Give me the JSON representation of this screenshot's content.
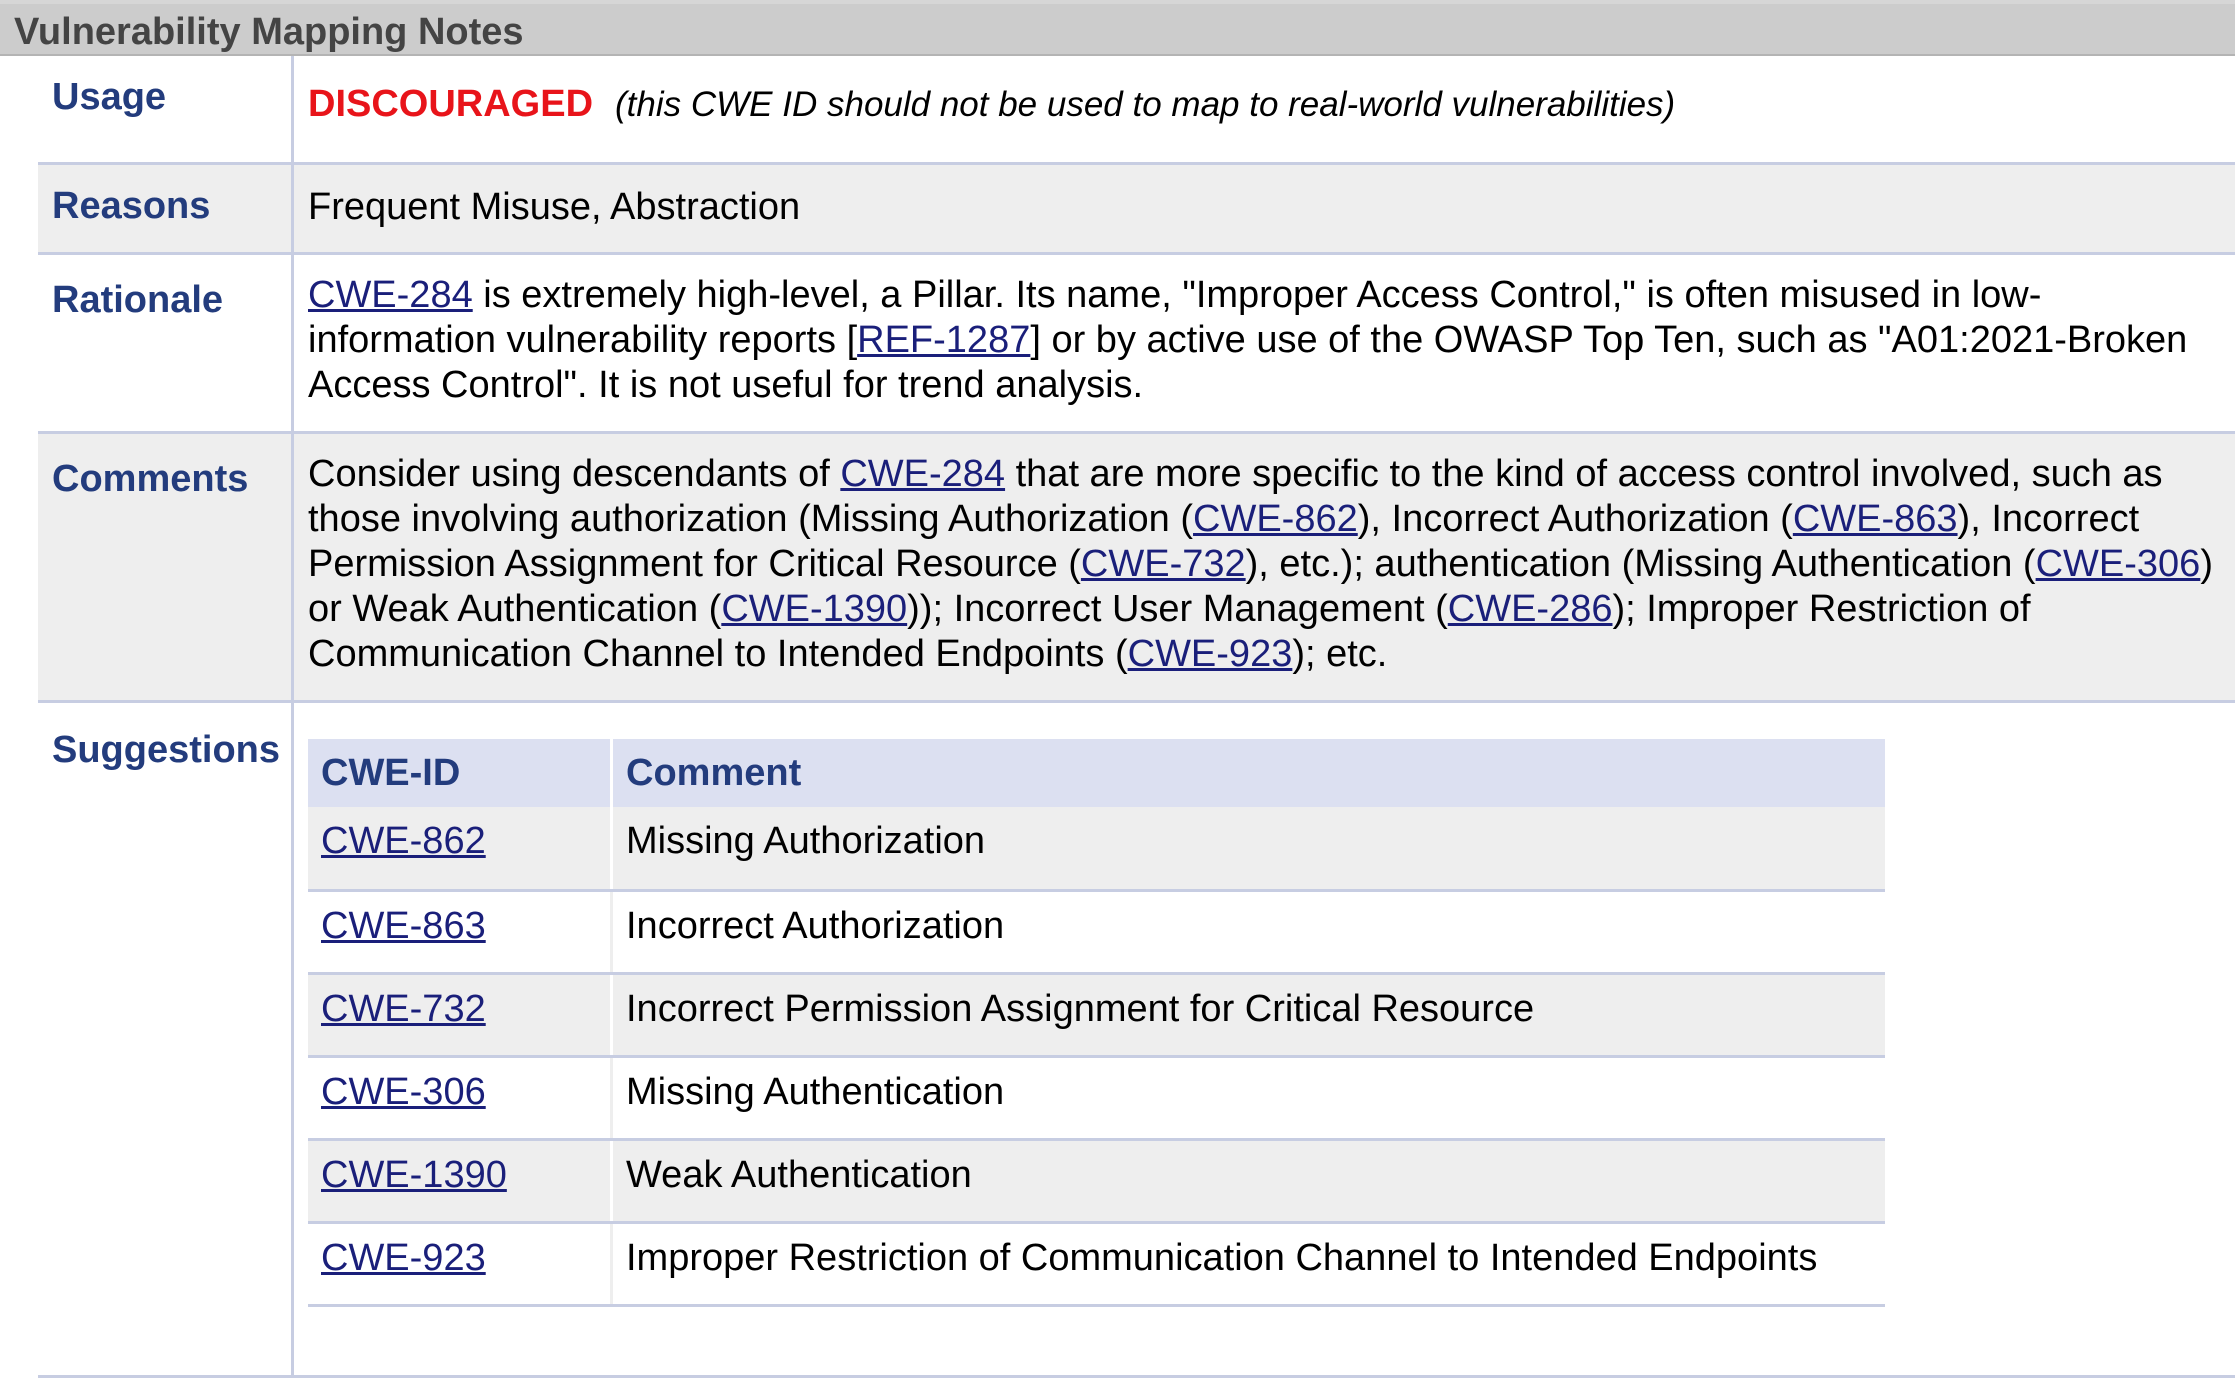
{
  "header": {
    "title": "Vulnerability Mapping Notes"
  },
  "usage": {
    "label": "Usage",
    "status": "DISCOURAGED",
    "note": "(this CWE ID should not be used to map to real-world vulnerabilities)"
  },
  "reasons": {
    "label": "Reasons",
    "text": "Frequent Misuse, Abstraction"
  },
  "rationale": {
    "label": "Rationale",
    "link1": "CWE-284",
    "text1": " is extremely high-level, a Pillar. Its name, \"Improper Access Control,\" is often misused in low-information vulnerability reports [",
    "link2": "REF-1287",
    "text2": "] or by active use of the OWASP Top Ten, such as \"A01:2021-Broken Access Control\". It is not useful for trend analysis."
  },
  "comments": {
    "label": "Comments",
    "t0": "Consider using descendants of ",
    "l0": "CWE-284",
    "t1": " that are more specific to the kind of access control involved, such as those involving authorization (Missing Authorization (",
    "l1": "CWE-862",
    "t2": "), Incorrect Authorization (",
    "l2": "CWE-863",
    "t3": "), Incorrect Permission Assignment for Critical Resource (",
    "l3": "CWE-732",
    "t4": "), etc.); authentication (Missing Authentication (",
    "l4": "CWE-306",
    "t5": ") or Weak Authentication (",
    "l5": "CWE-1390",
    "t6": ")); Incorrect User Management (",
    "l6": "CWE-286",
    "t7": "); Improper Restriction of Communication Channel to Intended Endpoints (",
    "l7": "CWE-923",
    "t8": "); etc."
  },
  "suggestions": {
    "label": "Suggestions",
    "columns": [
      "CWE-ID",
      "Comment"
    ],
    "rows": [
      {
        "id": "CWE-862",
        "comment": "Missing Authorization"
      },
      {
        "id": "CWE-863",
        "comment": "Incorrect Authorization"
      },
      {
        "id": "CWE-732",
        "comment": "Incorrect Permission Assignment for Critical Resource"
      },
      {
        "id": "CWE-306",
        "comment": "Missing Authentication"
      },
      {
        "id": "CWE-1390",
        "comment": "Weak Authentication"
      },
      {
        "id": "CWE-923",
        "comment": "Improper Restriction of Communication Channel to Intended Endpoints"
      }
    ]
  },
  "colors": {
    "label_blue": "#233c7d",
    "link": "#1a1f7a",
    "discouraged_red": "#e8141a",
    "row_gray": "#eeeeee",
    "table_header": "#dce0f1",
    "section_header": "#cccccc"
  }
}
